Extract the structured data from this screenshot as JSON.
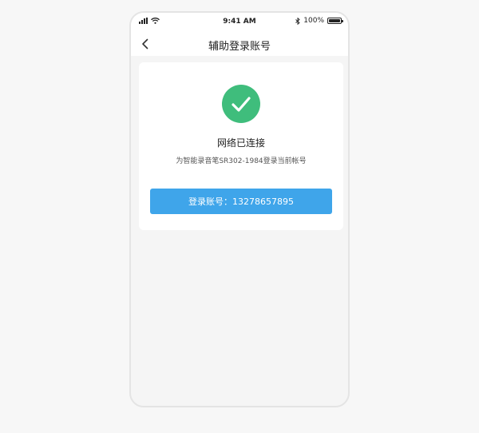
{
  "status_bar": {
    "time": "9:41 AM",
    "battery": "100%",
    "battery_level": 1.0
  },
  "header": {
    "title": "辅助登录账号",
    "back_icon": "chevron-left-icon"
  },
  "card": {
    "icon": "check-circle-icon",
    "accent_color": "#3fbd7c",
    "status_title": "网络已连接",
    "status_subtitle": "为智能录音笔SR302-1984登录当前帐号",
    "login_button_label": "登录账号：13278657895",
    "button_color": "#3fa5ea"
  }
}
